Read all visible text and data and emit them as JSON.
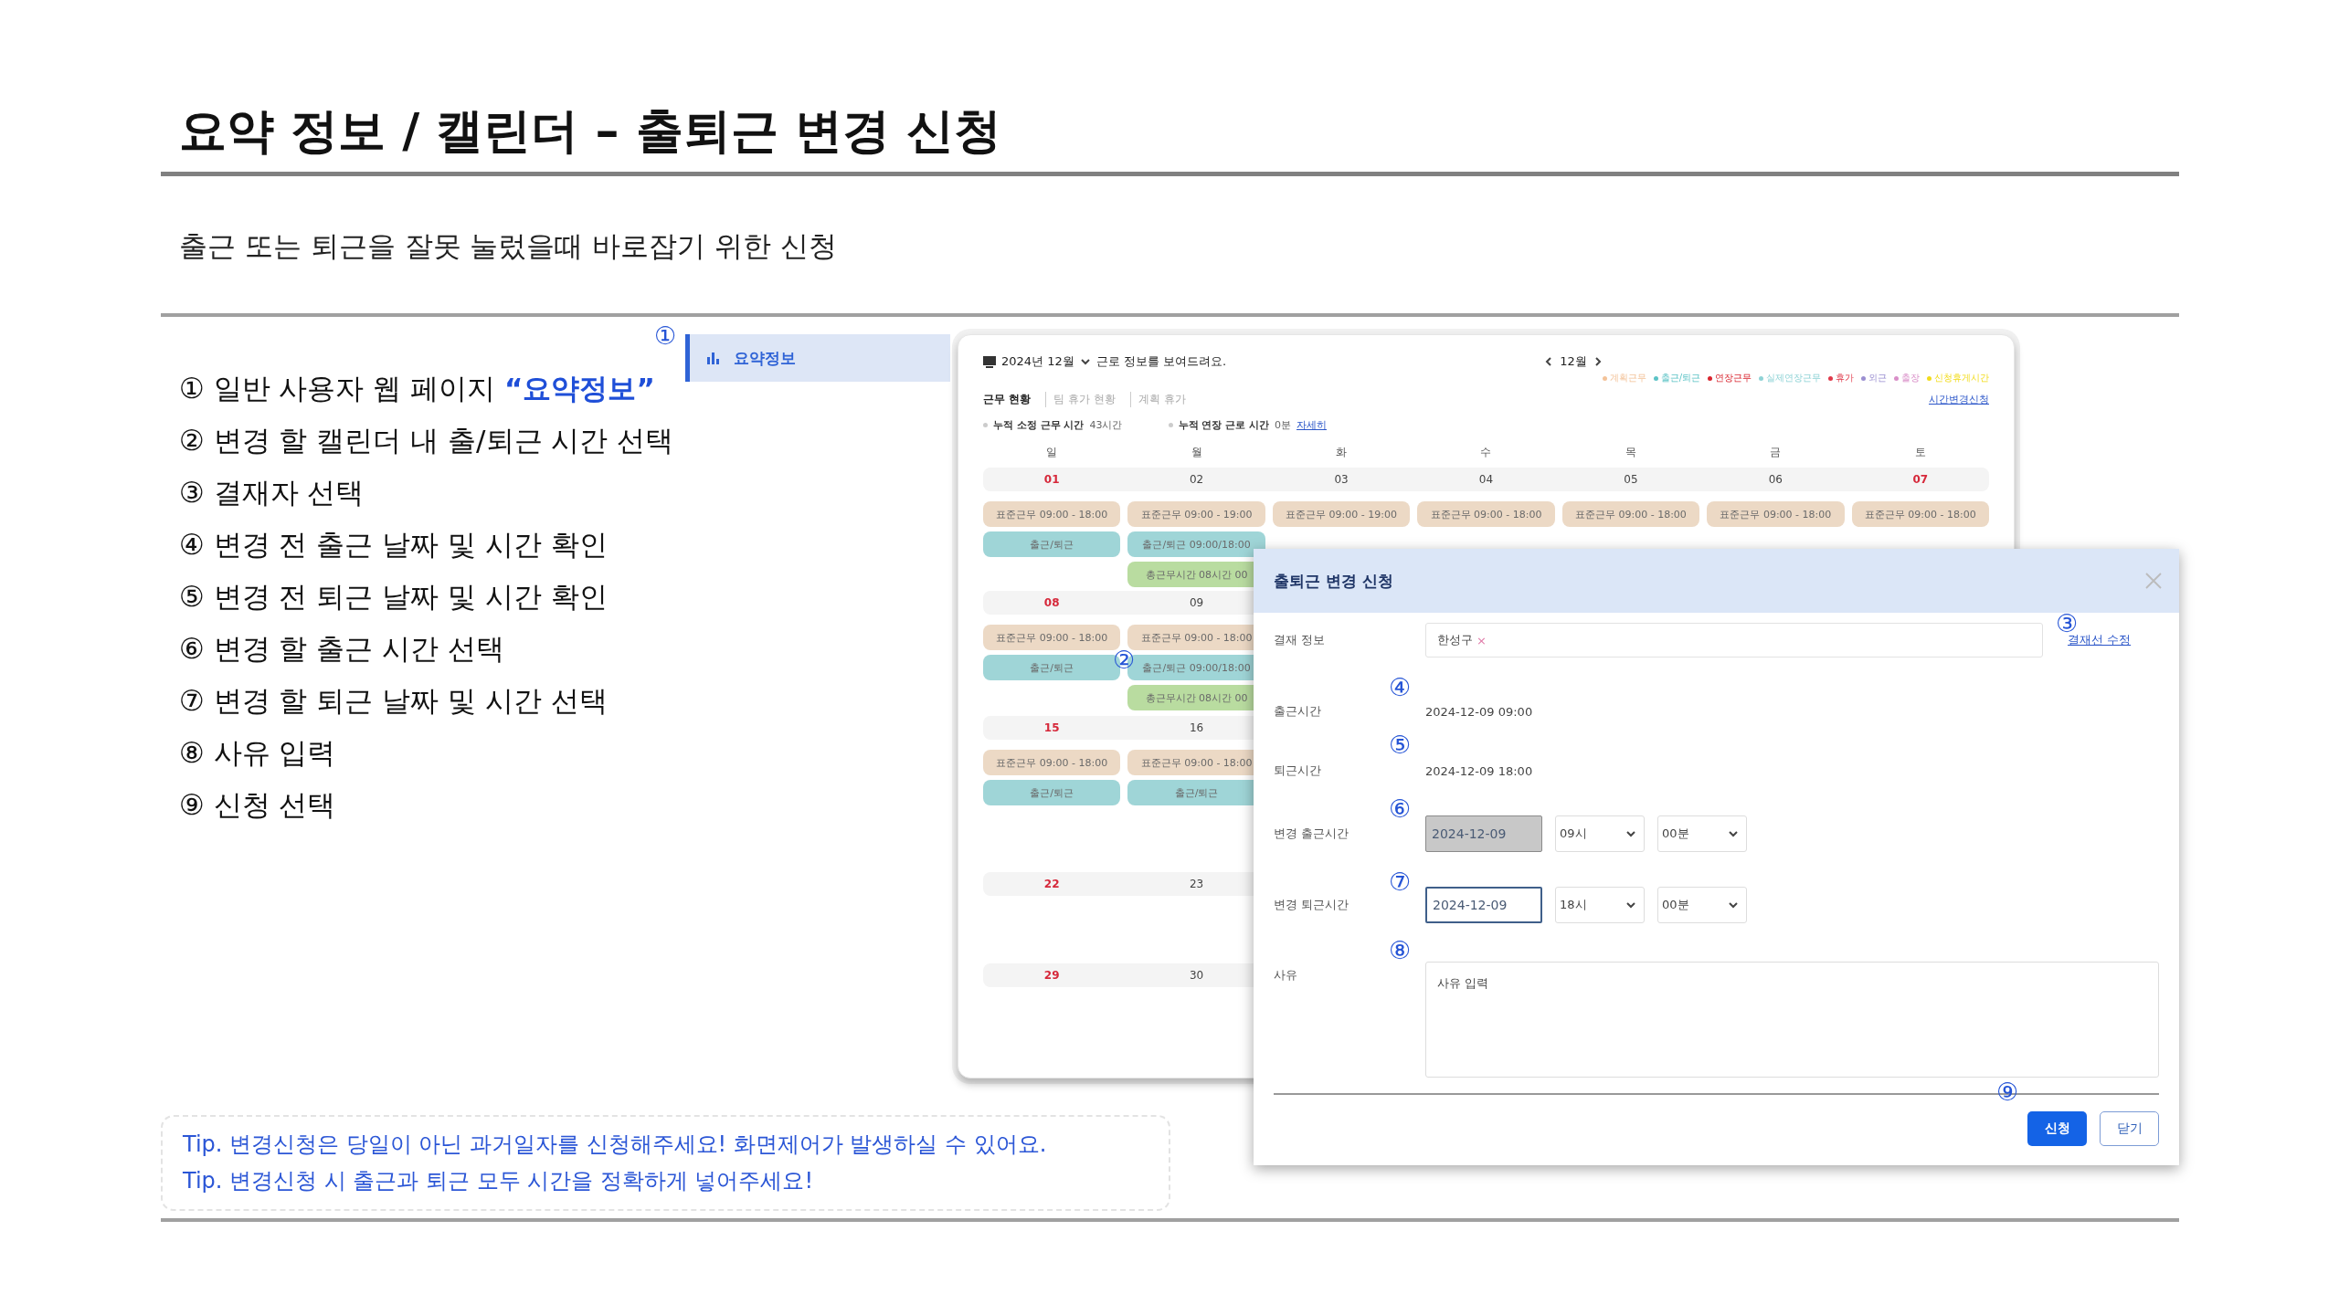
{
  "page": {
    "title": "요약 정보 / 캘린더 – 출퇴근 변경 신청",
    "subtitle": "출근 또는 퇴근을 잘못 눌렀을때 바로잡기 위한 신청"
  },
  "steps": [
    {
      "text": "① 일반 사용자 웹 페이지 ",
      "highlight": "“요약정보”"
    },
    {
      "text": "② 변경 할 캘린더 내 출/퇴근 시간 선택"
    },
    {
      "text": "③ 결재자 선택"
    },
    {
      "text": "④ 변경 전 출근 날짜 및 시간 확인"
    },
    {
      "text": "⑤ 변경 전 퇴근 날짜 및 시간 확인"
    },
    {
      "text": "⑥ 변경 할 출근 시간 선택"
    },
    {
      "text": "⑦ 변경 할 퇴근 날짜 및 시간 선택"
    },
    {
      "text": "⑧ 사유 입력"
    },
    {
      "text": "⑨ 신청 선택"
    }
  ],
  "tips": [
    "Tip. 변경신청은 당일이 아닌 과거일자를 신청해주세요! 화면제어가 발생하실 수 있어요.",
    "Tip. 변경신청 시 출근과 퇴근 모두 시간을 정확하게 넣어주세요!"
  ],
  "markers": [
    "①",
    "②",
    "③",
    "④",
    "⑤",
    "⑥",
    "⑦",
    "⑧",
    "⑨"
  ],
  "sidebar": {
    "items": [
      {
        "label": "요약정보",
        "selected": true
      }
    ]
  },
  "calendar": {
    "period": "2024년 12월",
    "caption": "근로 정보를 보여드려요.",
    "month": "12월",
    "legend": [
      {
        "label": "계획근무",
        "color": "#f3c39a"
      },
      {
        "label": "출근/퇴근",
        "color": "#5cc3c6"
      },
      {
        "label": "연장근무",
        "color": "#d9252f"
      },
      {
        "label": "실제연장근무",
        "color": "#8fd3d6"
      },
      {
        "label": "휴가",
        "color": "#e0394a"
      },
      {
        "label": "외근",
        "color": "#9b8fd1"
      },
      {
        "label": "출장",
        "color": "#d98fc8"
      },
      {
        "label": "신청휴게시간",
        "color": "#f2dc1c"
      }
    ],
    "tabs": [
      {
        "label": "근무 현황",
        "selected": true
      },
      {
        "label": "팀 휴가 현황",
        "selected": false
      },
      {
        "label": "계획 휴가",
        "selected": false
      }
    ],
    "request_link": "시간변경신청",
    "stats": [
      {
        "label": "누적 소정 근무 시간",
        "value": "43시간"
      },
      {
        "label": "누적 연장 근로 시간",
        "value": "0분",
        "link": "자세히"
      }
    ],
    "weekdays": [
      "일",
      "월",
      "화",
      "수",
      "목",
      "금",
      "토"
    ],
    "weeks": [
      {
        "days": [
          {
            "date": "01",
            "holiday": true,
            "events": [
              {
                "kind": "plan",
                "text": "표준근무 09:00 - 18:00"
              },
              {
                "kind": "attendance",
                "text": "출근/퇴근"
              }
            ]
          },
          {
            "date": "02",
            "holiday": false,
            "events": [
              {
                "kind": "plan",
                "text": "표준근무 09:00 - 19:00"
              },
              {
                "kind": "attendance",
                "text": "출근/퇴근 09:00/18:00"
              },
              {
                "kind": "total",
                "text": "총근무시간 08시간 00"
              }
            ]
          },
          {
            "date": "03",
            "holiday": false,
            "events": [
              {
                "kind": "plan",
                "text": "표준근무 09:00 - 19:00"
              }
            ]
          },
          {
            "date": "04",
            "holiday": false,
            "events": [
              {
                "kind": "plan",
                "text": "표준근무 09:00 - 18:00"
              }
            ]
          },
          {
            "date": "05",
            "holiday": false,
            "events": [
              {
                "kind": "plan",
                "text": "표준근무 09:00 - 18:00"
              }
            ]
          },
          {
            "date": "06",
            "holiday": false,
            "events": [
              {
                "kind": "plan",
                "text": "표준근무 09:00 - 18:00"
              }
            ]
          },
          {
            "date": "07",
            "holiday": true,
            "events": [
              {
                "kind": "plan",
                "text": "표준근무 09:00 - 18:00"
              }
            ]
          }
        ]
      },
      {
        "days": [
          {
            "date": "08",
            "holiday": true,
            "events": [
              {
                "kind": "plan",
                "text": "표준근무 09:00 - 18:00"
              },
              {
                "kind": "attendance",
                "text": "출근/퇴근"
              }
            ]
          },
          {
            "date": "09",
            "holiday": false,
            "events": [
              {
                "kind": "plan",
                "text": "표준근무 09:00 - 18:00"
              },
              {
                "kind": "attendance",
                "text": "출근/퇴근 09:00/18:00"
              },
              {
                "kind": "total",
                "text": "총근무시간 08시간 00"
              }
            ]
          }
        ]
      },
      {
        "days": [
          {
            "date": "15",
            "holiday": true,
            "events": [
              {
                "kind": "plan",
                "text": "표준근무 09:00 - 18:00"
              },
              {
                "kind": "attendance",
                "text": "출근/퇴근"
              }
            ]
          },
          {
            "date": "16",
            "holiday": false,
            "events": [
              {
                "kind": "plan",
                "text": "표준근무 09:00 - 18:00"
              },
              {
                "kind": "attendance",
                "text": "출근/퇴근"
              }
            ]
          }
        ]
      },
      {
        "days": [
          {
            "date": "22",
            "holiday": true
          },
          {
            "date": "23",
            "holiday": false
          }
        ]
      },
      {
        "days": [
          {
            "date": "29",
            "holiday": true
          },
          {
            "date": "30",
            "holiday": false
          }
        ]
      }
    ]
  },
  "dialog": {
    "title": "출퇴근 변경 신청",
    "approval": {
      "label": "결재 정보",
      "approver": "한성구",
      "remove": "×",
      "link": "결재선 수정"
    },
    "checkin": {
      "label": "출근시간",
      "value": "2024-12-09 09:00"
    },
    "checkout": {
      "label": "퇴근시간",
      "value": "2024-12-09 18:00"
    },
    "changes": [
      {
        "label": "변경 출근시간",
        "date": "2024-12-09",
        "focused": false,
        "disabled": true,
        "hour": "09시",
        "minute": "00분"
      },
      {
        "label": "변경 퇴근시간",
        "date": "2024-12-09",
        "focused": true,
        "disabled": false,
        "hour": "18시",
        "minute": "00분"
      }
    ],
    "reason": {
      "label": "사유",
      "placeholder": "사유 입력"
    },
    "buttons": [
      {
        "label": "신청",
        "kind": "primary"
      },
      {
        "label": "닫기",
        "kind": "secondary"
      }
    ]
  }
}
